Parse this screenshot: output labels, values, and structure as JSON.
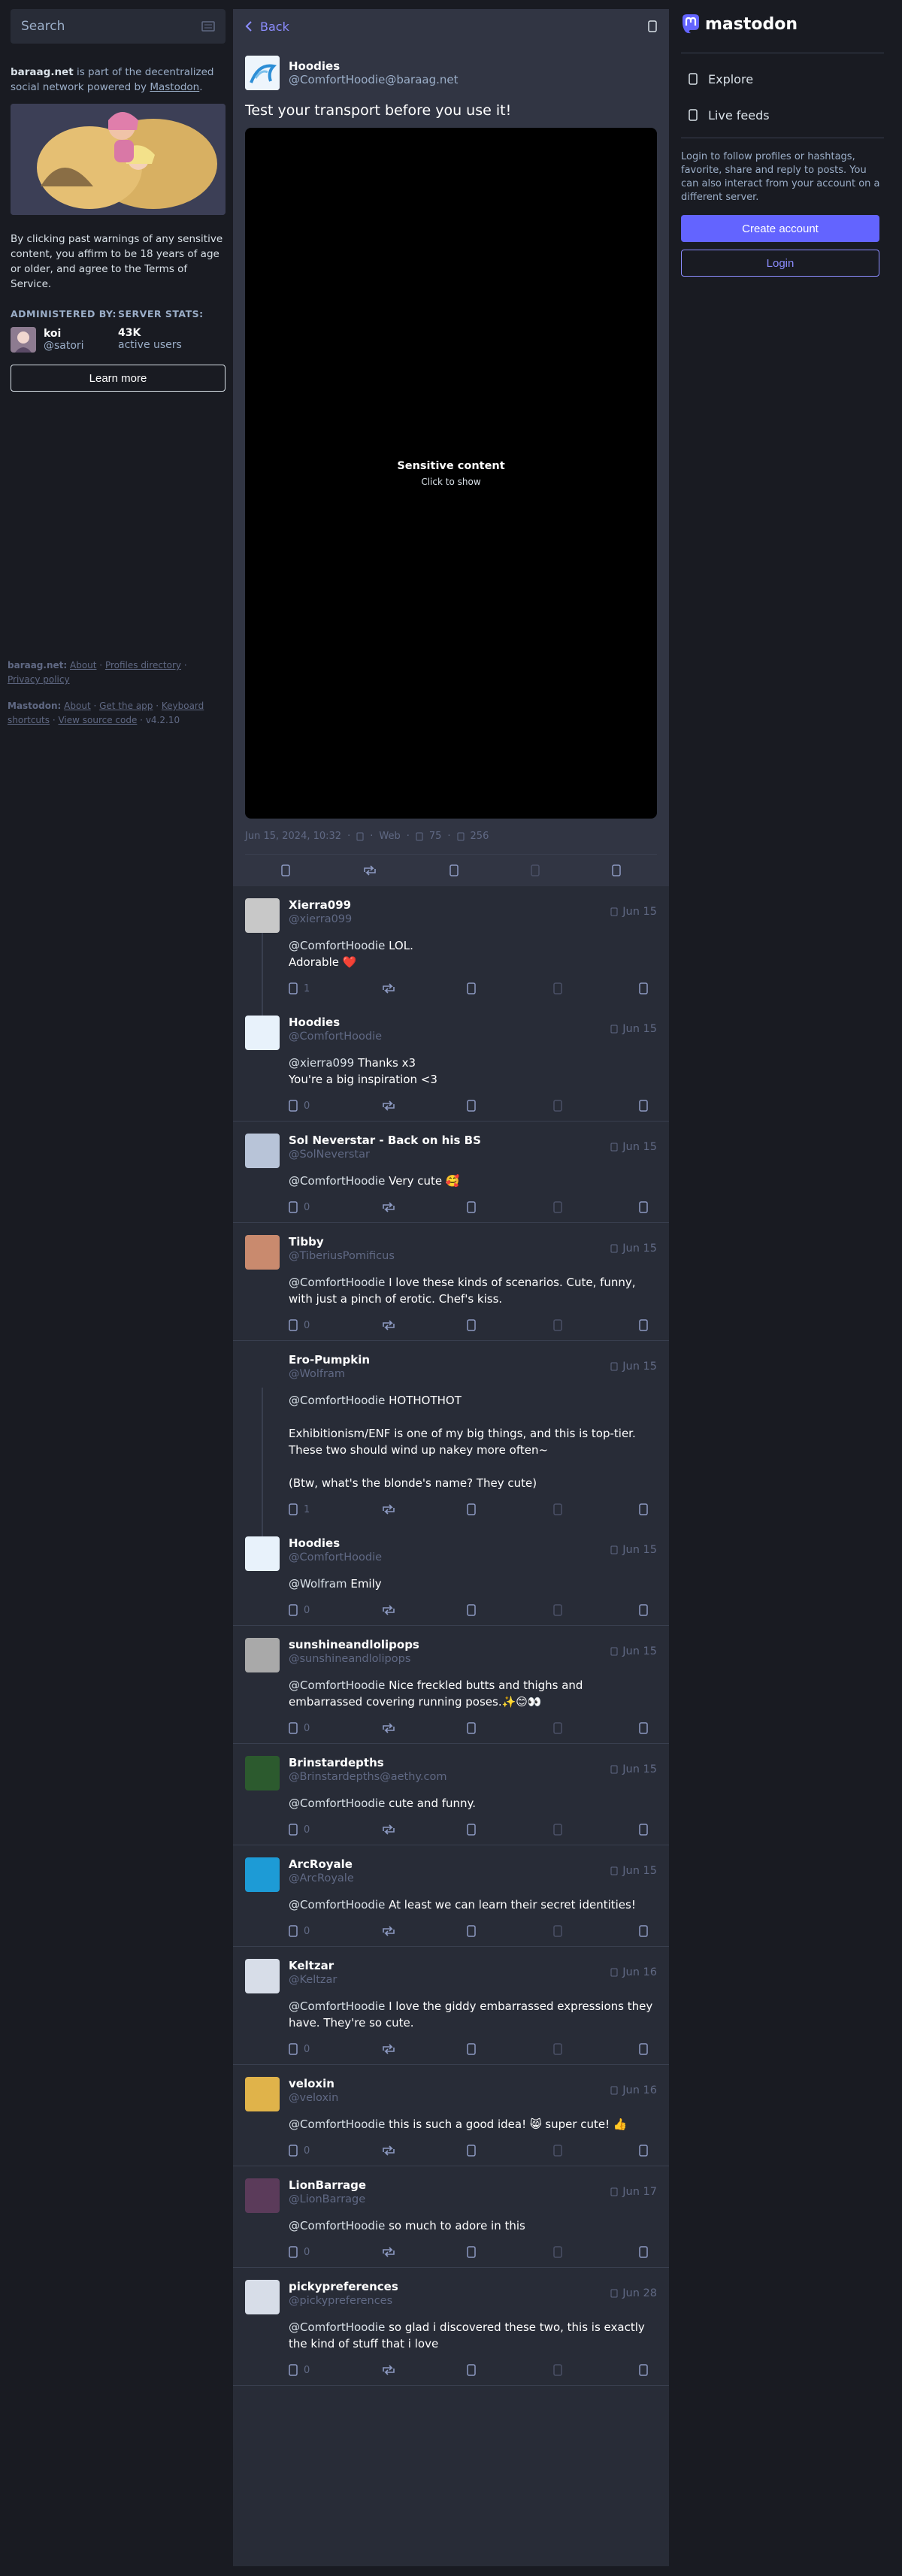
{
  "search": {
    "placeholder": "Search"
  },
  "server": {
    "domain": "baraag.net",
    "description_mid": " is part of the decentralized social network powered by ",
    "description_link": "Mastodon",
    "description_end": ".",
    "notice": "By clicking past warnings of any sensitive content, you affirm to be 18 years of age or older, and agree to the Terms of Service.",
    "admin_label": "ADMINISTERED BY:",
    "admin_name": "koi",
    "admin_handle": "@satori",
    "stats_label": "SERVER STATS:",
    "active_users": "43K",
    "active_users_label": "active users",
    "learn_more": "Learn more"
  },
  "footer": {
    "server_label": "baraag.net:",
    "server_links": [
      "About",
      "Profiles directory",
      "Privacy policy"
    ],
    "mastodon_label": "Mastodon:",
    "mastodon_links": [
      "About",
      "Get the app",
      "Keyboard shortcuts",
      "View source code"
    ],
    "version": "v4.2.10"
  },
  "header": {
    "back_label": "Back"
  },
  "focal": {
    "display_name": "Hoodies",
    "handle": "@ComfortHoodie@baraag.net",
    "content": "Test your transport before you use it!",
    "spoiler_title": "Sensitive content",
    "spoiler_sub": "Click to show",
    "date": "Jun 15, 2024, 10:32",
    "app": "Web",
    "boosts": "75",
    "favourites": "256"
  },
  "replies": [
    {
      "display_name": "Xierra099",
      "handle": "@xierra099",
      "time": "Jun 15",
      "mention": "@ComfortHoodie",
      "paragraphs": [
        "LOL.\nAdorable ❤️"
      ],
      "replies_count": "1",
      "avatar_color": "#c8c8c8",
      "connected": true
    },
    {
      "display_name": "Hoodies",
      "handle": "@ComfortHoodie",
      "time": "Jun 15",
      "mention": "@xierra099",
      "paragraphs": [
        "Thanks x3\nYou're a big inspiration <3"
      ],
      "replies_count": "0",
      "avatar_color": "#e8f2fb",
      "connected": false
    },
    {
      "display_name": "Sol Neverstar - Back on his BS",
      "handle": "@SolNeverstar",
      "time": "Jun 15",
      "mention": "@ComfortHoodie",
      "paragraphs": [
        "Very cute 🥰"
      ],
      "replies_count": "0",
      "avatar_color": "#b8c4d8",
      "connected": false
    },
    {
      "display_name": "Tibby",
      "handle": "@TiberiusPomificus",
      "time": "Jun 15",
      "mention": "@ComfortHoodie",
      "paragraphs": [
        "I love these kinds of scenarios. Cute, funny, with just a pinch of erotic. Chef's kiss."
      ],
      "replies_count": "0",
      "avatar_color": "#c98a6e",
      "connected": false
    },
    {
      "display_name": "Ero-Pumpkin",
      "handle": "@Wolfram",
      "time": "Jun 15",
      "mention": "@ComfortHoodie",
      "paragraphs": [
        "HOTHOTHOT",
        "Exhibitionism/ENF is one of my big things, and this is top-tier. These two should wind up nakey more often~",
        "(Btw, what's the blonde's name? They cute)"
      ],
      "replies_count": "1",
      "avatar_color": "#282c37",
      "connected": true
    },
    {
      "display_name": "Hoodies",
      "handle": "@ComfortHoodie",
      "time": "Jun 15",
      "mention": "@Wolfram",
      "paragraphs": [
        "Emily"
      ],
      "replies_count": "0",
      "avatar_color": "#e8f2fb",
      "connected": false
    },
    {
      "display_name": "sunshineandlolipops",
      "handle": "@sunshineandlolipops",
      "time": "Jun 15",
      "mention": "@ComfortHoodie",
      "paragraphs": [
        "Nice freckled butts and thighs and embarrassed covering running poses.✨😊👀"
      ],
      "replies_count": "0",
      "avatar_color": "#a9a9a9",
      "connected": false
    },
    {
      "display_name": "Brinstardepths",
      "handle": "@Brinstardepths@aethy.com",
      "time": "Jun 15",
      "mention": "@ComfortHoodie",
      "paragraphs": [
        "cute and funny."
      ],
      "replies_count": "0",
      "avatar_color": "#2c5a2e",
      "connected": false
    },
    {
      "display_name": "ArcRoyale",
      "handle": "@ArcRoyale",
      "time": "Jun 15",
      "mention": "@ComfortHoodie",
      "paragraphs": [
        "At least we can learn their secret identities!"
      ],
      "replies_count": "0",
      "avatar_color": "#1d9bd6",
      "connected": false
    },
    {
      "display_name": "Keltzar",
      "handle": "@Keltzar",
      "time": "Jun 16",
      "mention": "@ComfortHoodie",
      "paragraphs": [
        "I love the giddy embarrassed expressions they have. They're so cute."
      ],
      "replies_count": "0",
      "avatar_color": "#d7dde8",
      "connected": false
    },
    {
      "display_name": "veloxin",
      "handle": "@veloxin",
      "time": "Jun 16",
      "mention": "@ComfortHoodie",
      "paragraphs": [
        "this is such a good idea! 😸 super cute! 👍"
      ],
      "replies_count": "0",
      "avatar_color": "#e0b34a",
      "connected": false
    },
    {
      "display_name": "LionBarrage",
      "handle": "@LionBarrage",
      "time": "Jun 17",
      "mention": "@ComfortHoodie",
      "paragraphs": [
        "so much to adore in this"
      ],
      "replies_count": "0",
      "avatar_color": "#5b3b5a",
      "connected": false
    },
    {
      "display_name": "pickypreferences",
      "handle": "@pickypreferences",
      "time": "Jun 28",
      "mention": "@ComfortHoodie",
      "paragraphs": [
        "so glad i discovered these two, this is exactly the kind of stuff that i love"
      ],
      "replies_count": "0",
      "avatar_color": "#d7dde8",
      "connected": false
    }
  ],
  "right": {
    "logo": "mastodon",
    "nav": [
      "Explore",
      "Live feeds"
    ],
    "signup_text": "Login to follow profiles or hashtags, favorite, share and reply to posts. You can also interact from your account on a different server.",
    "create_account": "Create account",
    "login": "Login"
  },
  "colors": {
    "accent": "#6364ff",
    "accent_light": "#8c8dff",
    "background": "#191b22",
    "panel": "#282c37",
    "heart": "#e0245e"
  }
}
